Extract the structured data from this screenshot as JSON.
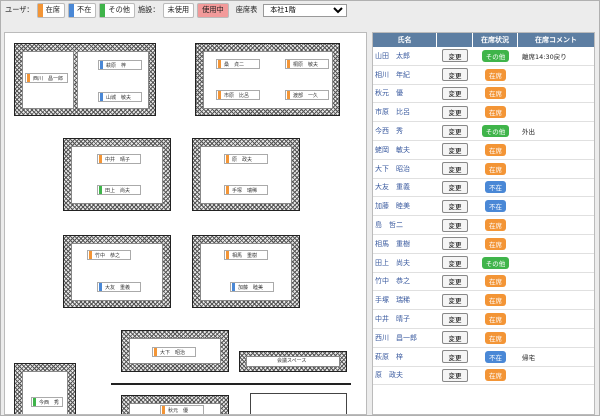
{
  "colors": {
    "present": "#f39536",
    "absent": "#4a88d6",
    "other": "#3fb44a",
    "unused_seat": "#ffffff",
    "in_use_seat": "#f29a9a",
    "header": "#5d7ea2"
  },
  "legend": {
    "user_label": "ユーザ：",
    "present": "在席",
    "absent": "不在",
    "other": "その他",
    "facility_label": "施設：",
    "unused": "未使用",
    "in_use": "使用中",
    "seating_label": "座席表",
    "seating_selected": "本社1階"
  },
  "floor": {
    "seats": [
      {
        "name": "西川　昌一郎",
        "status": "present"
      },
      {
        "name": "萩原　梓",
        "status": "absent"
      },
      {
        "name": "山城　敏夫",
        "status": "absent"
      },
      {
        "name": "桑　貞二",
        "status": "present"
      },
      {
        "name": "桐原　敏夫",
        "status": "present"
      },
      {
        "name": "市原　比呂",
        "status": "present"
      },
      {
        "name": "渡部　一久",
        "status": "present"
      },
      {
        "name": "中井　晴子",
        "status": "present"
      },
      {
        "name": "田上　尚夫",
        "status": "other"
      },
      {
        "name": "原　政夫",
        "status": "present"
      },
      {
        "name": "手塚　瑞稀",
        "status": "present"
      },
      {
        "name": "竹中　恭之",
        "status": "present"
      },
      {
        "name": "大友　重義",
        "status": "absent"
      },
      {
        "name": "相馬　重樹",
        "status": "present"
      },
      {
        "name": "加藤　睦美",
        "status": "absent"
      },
      {
        "name": "大下　昭治",
        "status": "present"
      },
      {
        "name": "今西　秀",
        "status": "other"
      },
      {
        "name": "秋元　優",
        "status": "present"
      }
    ],
    "meeting_space": "会議スペース"
  },
  "table": {
    "headers": {
      "name": "氏名",
      "status": "在席状況",
      "comment": "在席コメント"
    },
    "change_label": "変更",
    "rows": [
      {
        "name": "山田　太郎",
        "status": "その他",
        "kind": "other",
        "comment": "離席14:30戻り"
      },
      {
        "name": "相川　年紀",
        "status": "在席",
        "kind": "present",
        "comment": ""
      },
      {
        "name": "秋元　優",
        "status": "在席",
        "kind": "present",
        "comment": ""
      },
      {
        "name": "市原　比呂",
        "status": "在席",
        "kind": "present",
        "comment": ""
      },
      {
        "name": "今西　秀",
        "status": "その他",
        "kind": "other",
        "comment": "外出"
      },
      {
        "name": "蛯岡　敏夫",
        "status": "在席",
        "kind": "present",
        "comment": ""
      },
      {
        "name": "大下　昭治",
        "status": "在席",
        "kind": "present",
        "comment": ""
      },
      {
        "name": "大友　重義",
        "status": "不在",
        "kind": "absent",
        "comment": ""
      },
      {
        "name": "加藤　睦美",
        "status": "不在",
        "kind": "absent",
        "comment": ""
      },
      {
        "name": "島　哲二",
        "status": "在席",
        "kind": "present",
        "comment": ""
      },
      {
        "name": "相馬　重樹",
        "status": "在席",
        "kind": "present",
        "comment": ""
      },
      {
        "name": "田上　尚夫",
        "status": "その他",
        "kind": "other",
        "comment": ""
      },
      {
        "name": "竹中　恭之",
        "status": "在席",
        "kind": "present",
        "comment": ""
      },
      {
        "name": "手塚　瑞稀",
        "status": "在席",
        "kind": "present",
        "comment": ""
      },
      {
        "name": "中井　晴子",
        "status": "在席",
        "kind": "present",
        "comment": ""
      },
      {
        "name": "西川　昌一郎",
        "status": "在席",
        "kind": "present",
        "comment": ""
      },
      {
        "name": "萩原　梓",
        "status": "不在",
        "kind": "absent",
        "comment": "帰宅"
      },
      {
        "name": "原　政夫",
        "status": "在席",
        "kind": "present",
        "comment": ""
      }
    ]
  }
}
